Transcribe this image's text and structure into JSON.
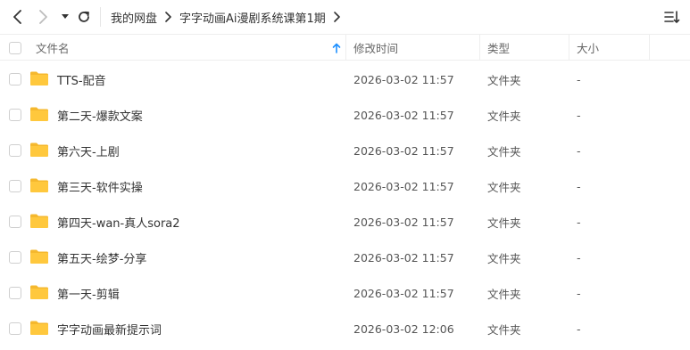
{
  "toolbar": {
    "back_icon": "chevron-left-icon",
    "forward_icon": "chevron-right-icon",
    "dropdown_icon": "caret-down-icon",
    "refresh_icon": "refresh-icon",
    "sort_icon": "sort-list-icon",
    "breadcrumb": [
      "我的网盘",
      "字字动画Ai漫剧系统课第1期"
    ],
    "breadcrumb_sep_icon": "chevron-right-icon"
  },
  "table": {
    "columns": {
      "name": "文件名",
      "modified": "修改时间",
      "type": "类型",
      "size": "大小"
    },
    "sort_icon": "arrow-up-icon",
    "sort_color": "#1e90ff",
    "folder_color": "#ffc83d",
    "rows": [
      {
        "name": "TTS-配音",
        "modified": "2026-03-02 11:57",
        "type": "文件夹",
        "size": "-"
      },
      {
        "name": "第二天-爆款文案",
        "modified": "2026-03-02 11:57",
        "type": "文件夹",
        "size": "-"
      },
      {
        "name": "第六天-上剧",
        "modified": "2026-03-02 11:57",
        "type": "文件夹",
        "size": "-"
      },
      {
        "name": "第三天-软件实操",
        "modified": "2026-03-02 11:57",
        "type": "文件夹",
        "size": "-"
      },
      {
        "name": "第四天-wan-真人sora2",
        "modified": "2026-03-02 11:57",
        "type": "文件夹",
        "size": "-"
      },
      {
        "name": "第五天-绘梦-分享",
        "modified": "2026-03-02 11:57",
        "type": "文件夹",
        "size": "-"
      },
      {
        "name": "第一天-剪辑",
        "modified": "2026-03-02 11:57",
        "type": "文件夹",
        "size": "-"
      },
      {
        "name": "字字动画最新提示词",
        "modified": "2026-03-02 12:06",
        "type": "文件夹",
        "size": "-"
      }
    ]
  }
}
